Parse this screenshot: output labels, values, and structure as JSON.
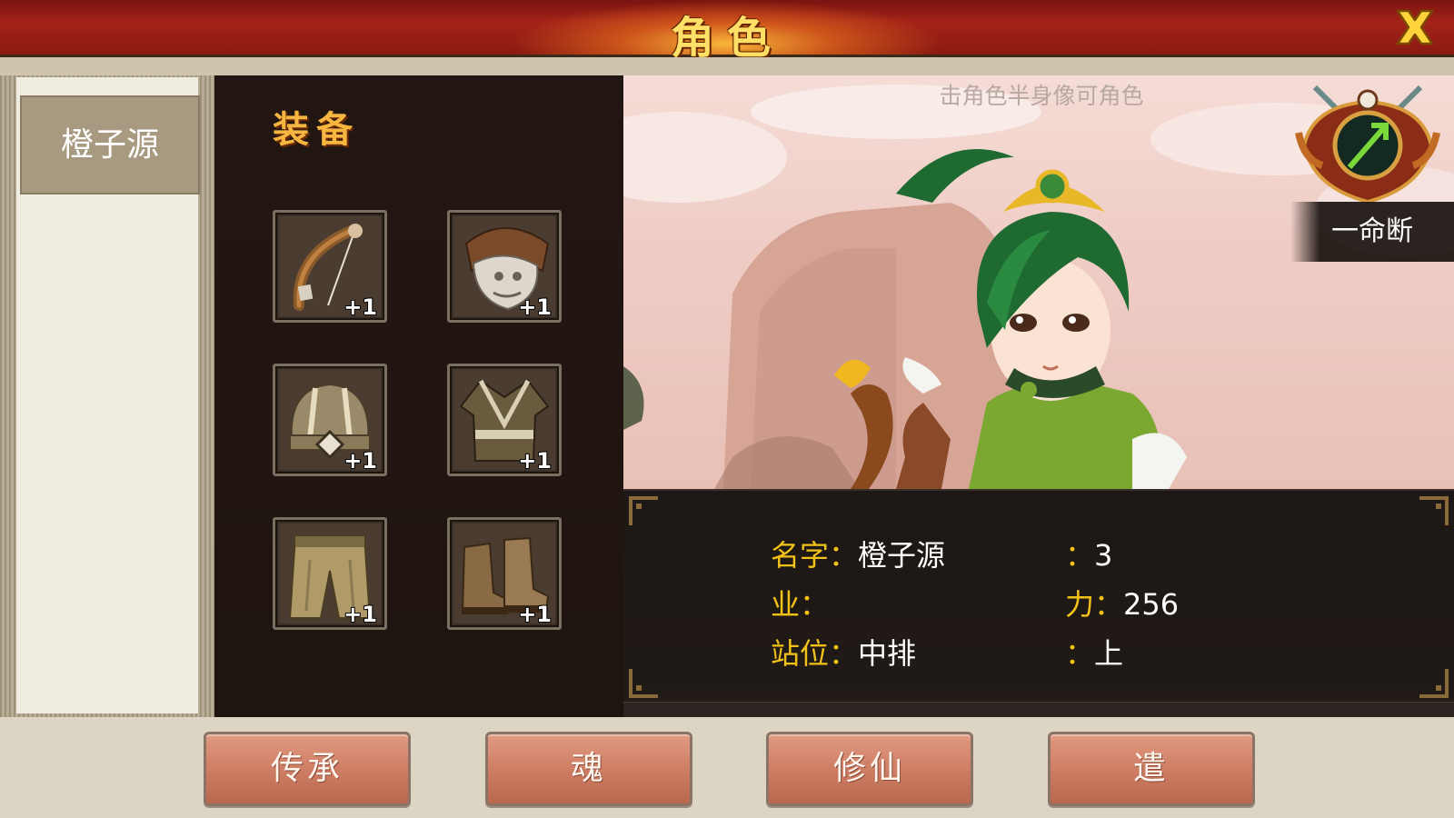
{
  "header": {
    "title": "角色",
    "close_icon": "close-icon"
  },
  "character_list": [
    {
      "name": "橙子源"
    }
  ],
  "equipment": {
    "title": "装备",
    "slots": [
      {
        "icon": "bow-icon",
        "level": "+1"
      },
      {
        "icon": "armor-plate-icon",
        "level": "+1"
      },
      {
        "icon": "helmet-icon",
        "level": "+1"
      },
      {
        "icon": "robe-icon",
        "level": "+1"
      },
      {
        "icon": "pants-icon",
        "level": "+1"
      },
      {
        "icon": "boots-icon",
        "level": "+1"
      }
    ]
  },
  "portrait": {
    "hint": "击角色半身像可角色",
    "skill_name": "一命断",
    "emblem_icon": "skill-emblem-icon"
  },
  "info": {
    "name_label": "名字：",
    "name_value": "橙子源",
    "job_label": "业：",
    "job_value": "",
    "position_label": "站位：",
    "position_value": "中排",
    "level_label": "：",
    "level_value": "3",
    "power_label": "力：",
    "power_value": "256",
    "extra_label": "：",
    "extra_value": "上"
  },
  "buttons": {
    "inherit": "传承",
    "soul": "魂",
    "cultivate": "修仙",
    "relic": "遣"
  },
  "colors": {
    "header_red": "#a32218",
    "title_gold": "#ffe067",
    "label_yellow": "#f2c218",
    "button_salmon": "#cc7c62"
  }
}
